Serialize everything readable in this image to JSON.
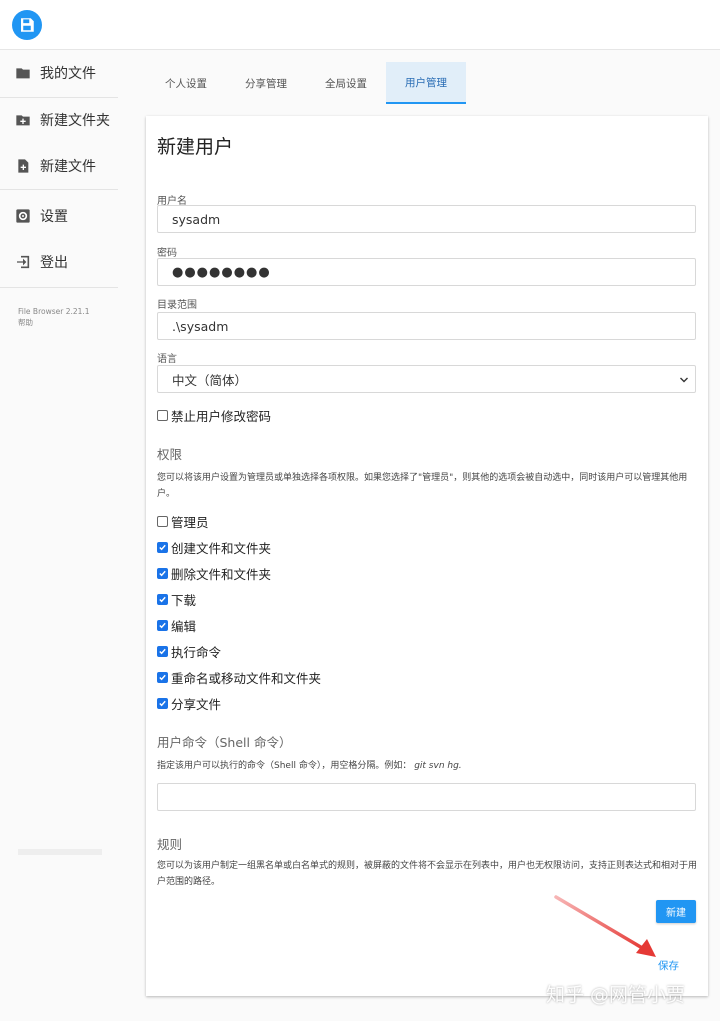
{
  "sidebar": {
    "items": [
      {
        "label": "我的文件",
        "icon": "folder-icon"
      },
      {
        "label": "新建文件夹",
        "icon": "add-folder-icon"
      },
      {
        "label": "新建文件",
        "icon": "add-file-icon"
      },
      {
        "label": "设置",
        "icon": "gear-icon"
      },
      {
        "label": "登出",
        "icon": "logout-icon"
      }
    ],
    "version": "File Browser 2.21.1",
    "help": "帮助"
  },
  "tabs": [
    {
      "label": "个人设置"
    },
    {
      "label": "分享管理"
    },
    {
      "label": "全局设置"
    },
    {
      "label": "用户管理",
      "active": true
    }
  ],
  "form": {
    "title": "新建用户",
    "username_label": "用户名",
    "username_value": "sysadm",
    "password_label": "密码",
    "password_value": "●●●●●●●●",
    "scope_label": "目录范围",
    "scope_value": ".\\sysadm",
    "language_label": "语言",
    "language_value": "中文（简体）",
    "lock_password_label": "禁止用户修改密码",
    "lock_password_checked": false
  },
  "permissions": {
    "title": "权限",
    "description": "您可以将该用户设置为管理员或单独选择各项权限。如果您选择了\"管理员\"，则其他的选项会被自动选中，同时该用户可以管理其他用户。",
    "items": [
      {
        "label": "管理员",
        "checked": false
      },
      {
        "label": "创建文件和文件夹",
        "checked": true
      },
      {
        "label": "删除文件和文件夹",
        "checked": true
      },
      {
        "label": "下载",
        "checked": true
      },
      {
        "label": "编辑",
        "checked": true
      },
      {
        "label": "执行命令",
        "checked": true
      },
      {
        "label": "重命名或移动文件和文件夹",
        "checked": true
      },
      {
        "label": "分享文件",
        "checked": true
      }
    ]
  },
  "commands": {
    "title": "用户命令（Shell 命令）",
    "description_prefix": "指定该用户可以执行的命令（Shell 命令），用空格分隔。例如：",
    "description_example": "git svn hg.",
    "value": ""
  },
  "rules": {
    "title": "规则",
    "description": "您可以为该用户制定一组黑名单或白名单式的规则，被屏蔽的文件将不会显示在列表中，用户也无权限访问，支持正则表达式和相对于用户范围的路径。"
  },
  "buttons": {
    "new_label": "新建",
    "save_label": "保存"
  },
  "watermark": "知乎 @网管小贾",
  "colors": {
    "accent": "#2196f3",
    "checkbox": "#1a73e8",
    "arrow": "#e53935"
  }
}
